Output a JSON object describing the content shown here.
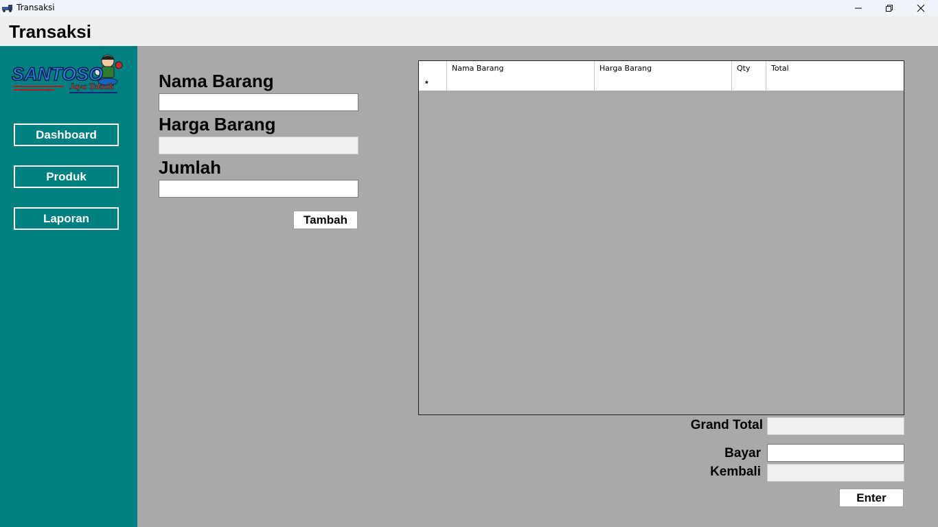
{
  "window": {
    "title": "Transaksi"
  },
  "header": {
    "title": "Transaksi"
  },
  "sidebar": {
    "logo": {
      "brand": "SANTOSO",
      "tagline": "Jaya Teknik"
    },
    "items": [
      {
        "label": "Dashboard"
      },
      {
        "label": "Produk"
      },
      {
        "label": "Laporan"
      }
    ]
  },
  "form": {
    "nama_barang": {
      "label": "Nama Barang",
      "value": ""
    },
    "harga_barang": {
      "label": "Harga Barang",
      "value": ""
    },
    "jumlah": {
      "label": "Jumlah",
      "value": ""
    },
    "add_button": "Tambah"
  },
  "grid": {
    "columns": [
      "Nama Barang",
      "Harga Barang",
      "Qty",
      "Total"
    ],
    "new_row_indicator": "*"
  },
  "totals": {
    "grand_total": {
      "label": "Grand Total",
      "value": ""
    },
    "bayar": {
      "label": "Bayar",
      "value": ""
    },
    "kembali": {
      "label": "Kembali",
      "value": ""
    },
    "enter_button": "Enter"
  },
  "colors": {
    "sidebar": "#008080",
    "content_bg": "#a9a9a9",
    "header_bg": "#efefef"
  }
}
